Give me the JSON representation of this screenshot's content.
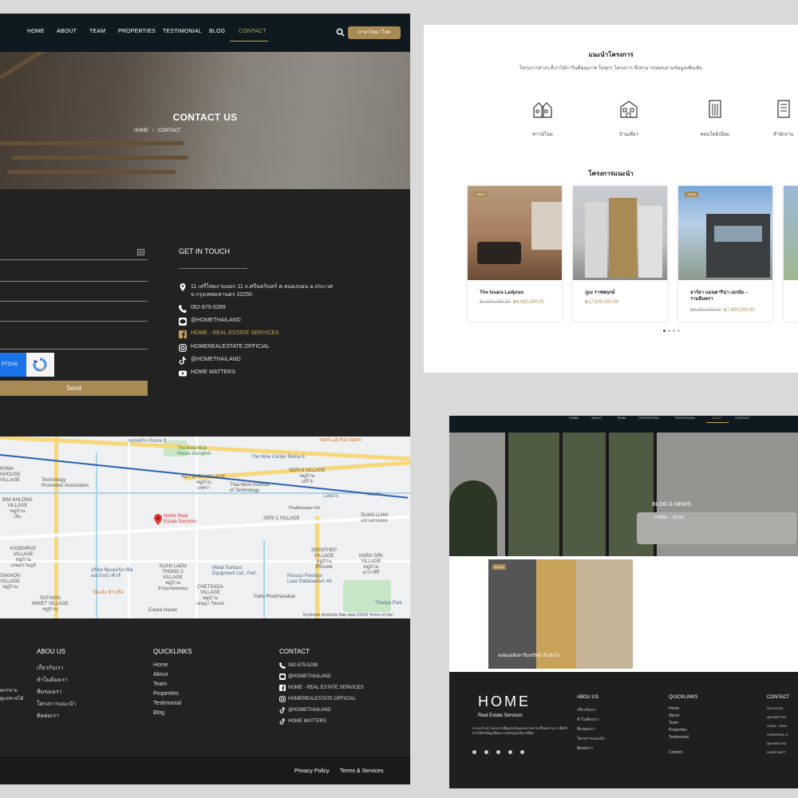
{
  "left": {
    "nav": {
      "items": [
        "HOME",
        "ABOUT",
        "TEAM",
        "PROPERTIES",
        "TESTIMONIAL",
        "BLOG",
        "CONTACT"
      ],
      "lang_button": "ภาษาไทย / ไทย"
    },
    "hero": {
      "title": "CONTACT US",
      "crumb_home": "HOME",
      "crumb_current": "CONTACT"
    },
    "form": {
      "captcha_label": "PTCHA",
      "send_label": "Send"
    },
    "get_in_touch": {
      "title": "GET IN TOUCH",
      "address": "11 เสรีไทยงามออก 11 ถ.ศรีนครินทร์ ต.หนองบอน อ.ประเวศ จ.กรุงเทพมหานคร 10250",
      "phone": "062-879-5289",
      "line": "@HOMETHAILAND",
      "facebook": "HOME - REAL ESTATE SERVICES",
      "instagram": "HOMEREALESTATE.OFFICIAL",
      "tiktok": "@HOMETHAILAND",
      "youtube": "HOME MATTERS"
    },
    "map": {
      "pin_label": "Home Real\nEstate Services",
      "labels": {
        "botanical": "The Botanical\nHouse Bangkok",
        "nine": "The Nine Center Rama 9",
        "yard": "Yard Lab Pat Udom",
        "home_rama9": "HomePro Rama 9",
        "ketsara": "KETSARA VILLAGE\nหมู่บ้าน\nเกศรา",
        "seri8": "SERI 8 VILLAGE\nหมู่บ้าน\nเสรี 8",
        "techno": "Technology\nPromotion Association",
        "thai_nichi": "Thai-Nichi Institute\nof Technology",
        "lotus": "Lotus's",
        "hua": "Hua Ma",
        "rama": "RAMA\nNHOUSE\nVILLAGE",
        "bimkhlong": "BIM KHLONG\nVILLAGE\nหมู่บ้าน\nเงิน",
        "seri1": "SERI 1 VILLAGE",
        "suan_luang": "SUAN LUAN\nแขวงสวนหล",
        "phatthanakan": "Phatthanakan Rd",
        "kasemrat": "KASEMRAT\nVILLAGE\nหมู่บ้าน\nเกษมราษฎร์",
        "sirinthep": "SIRINTHEP\nVILLAGE\nหมู่บ้าน\nสิรินเทพ",
        "nara": "NARA SIRI\nVILLAGE\nหมู่บ้าน\nนาราสิริ",
        "suan_laem": "SUAN LAEM\nTHONG 2\nVILLAGE\nหมู่บ้าน\nสวนแหลมทอง",
        "metal": "Metal Surface\nEquipment Ltd., Part.",
        "pasuko": "Pasuco Prestige\nLuxe Pattanakarn 44",
        "chetsada": "CHETSADA\nVILLAGE\nหมู่บ้าน\nเจษฎา วิลเลจ",
        "patio": "Patio Phatthanakan",
        "sakhon": "SAKHON\nVILLAGE\nหมู่บ้าน",
        "sathian": "SATHIAN\nNIWET VILLAGE\nหมู่บ้าน",
        "estara": "Estara Haven",
        "thanya": "Thanya Park",
        "bank": "บริษัท ฟิลเตอร์อาชีพ\nออนไลน์ เซ้าส์",
        "wat": "วัดแจ้ง ข้าวเรือ"
      },
      "footer": "Keyboard shortcuts   Map data ©2022   Terms of Use"
    },
    "footer": {
      "about_title": "ABOU US",
      "about_links": [
        "เกี่ยวกับเรา",
        "ทำไมต้องเรา",
        "ทีมของเรา",
        "โครงการแนะนำ",
        "ติดต่อเรา"
      ],
      "left_text": [
        "ตกรขาย",
        "ดูแลขายได้"
      ],
      "quick_title": "QUICKLINKS",
      "quick_links": [
        "Home",
        "About",
        "Team",
        "Properties",
        "Testimonial",
        "Blog"
      ],
      "contact_title": "CONTACT",
      "contact_items": [
        "062-879-5289",
        "@HOMETHAILAND",
        "HOME - REAL ESTATE SERVICES",
        "HOMEREALESTATE.OFFICIAL",
        "@HOMETHAILAND",
        "HOME MATTERS"
      ],
      "bottom_links": [
        "Privacy Policy",
        "Terms & Services"
      ]
    }
  },
  "right_top": {
    "section1_title": "แนะนำโครงการ",
    "section1_sub": "โครงการต่างๆ ที่เราได้การันตีคุณภาพ ในทุกๆ โครงการ ซึ่งสามารถสอบถามข้อมูลเพิ่มเติม",
    "categories": [
      "ทาวน์โฮม",
      "บ้านเดี่ยว",
      "คอนโดมิเนียม",
      "สำนักงาน"
    ],
    "section2_title": "โครงการแนะนำ",
    "cards": [
      {
        "sale": "SALE!",
        "name": "The Issara Ladprao",
        "old": "฿4,500,000.00",
        "price": "฿4,000,000.00"
      },
      {
        "sale": "",
        "name": "ภูเม ราชพฤกษ์",
        "old": "",
        "price": "฿17,500,000.00"
      },
      {
        "sale": "SALE!",
        "name": "อาร์ยา แมนดาริน่า เอกมัย – รามอินทรา",
        "old": "฿8,990,000.00",
        "price": "฿7,800,000.00"
      }
    ]
  },
  "right_bottom": {
    "nav_items": [
      "HOME",
      "ABOUT",
      "TEAM",
      "PROPERTIES",
      "TESTIMONIAL",
      "BLOG",
      "CONTACT"
    ],
    "hero_title": "BLOG & NEWS",
    "crumb_home": "HOME",
    "crumb_current": "BLOG",
    "post_badge": "BLOG",
    "post_title": "ลงทุนอสังหาริมทรัพย์ เริ่มยังไง",
    "brand": "HOME",
    "brand_sub": "Real Estate Services",
    "brand_desc": "บางกะปิ 100 โครงการที่คุณสนใจและอยากทราบ ซึ่งขอจากเรา เพื่อให้ท่านได้รับข้อมูลที่เหมาะสมกับคุณได้มากที่สุด",
    "about_title": "ABOU US",
    "about_links": [
      "เกี่ยวกับเรา",
      "ทำไมต้องเรา",
      "ทีมของเรา",
      "โครงการแนะนำ",
      "ติดต่อเรา"
    ],
    "quick_title": "QUICKLINKS",
    "quick_links": [
      "Home",
      "About",
      "Team",
      "Properties",
      "Testimonial",
      "Contact"
    ],
    "contact_title": "CONTACT",
    "contact_items": [
      "062-879-52",
      "@HOMETHA",
      "HOME - REAL",
      "HOMEREAL.O",
      "@HOMETHA",
      "HOME MATT"
    ]
  }
}
